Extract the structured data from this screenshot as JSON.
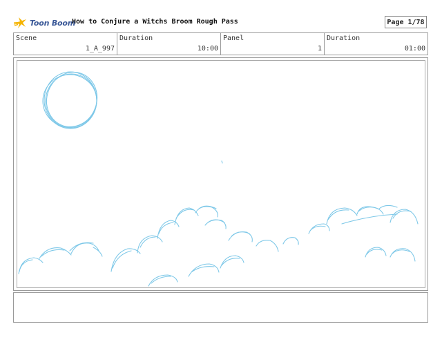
{
  "header": {
    "logo_text": "Toon Boom",
    "title": "How to Conjure a Witchs Broom Rough Pass",
    "page_label": "Page",
    "page_value": "1/78"
  },
  "info": {
    "scene_label": "Scene",
    "scene_value": "1_A_997",
    "scene_duration_label": "Duration",
    "scene_duration_value": "10:00",
    "panel_label": "Panel",
    "panel_value": "1",
    "panel_duration_label": "Duration",
    "panel_duration_value": "01:00"
  },
  "colors": {
    "sketch_stroke": "#7ec8e8",
    "logo_star": "#f5b400",
    "logo_text": "#3b5998"
  },
  "notes": {
    "text": ""
  }
}
